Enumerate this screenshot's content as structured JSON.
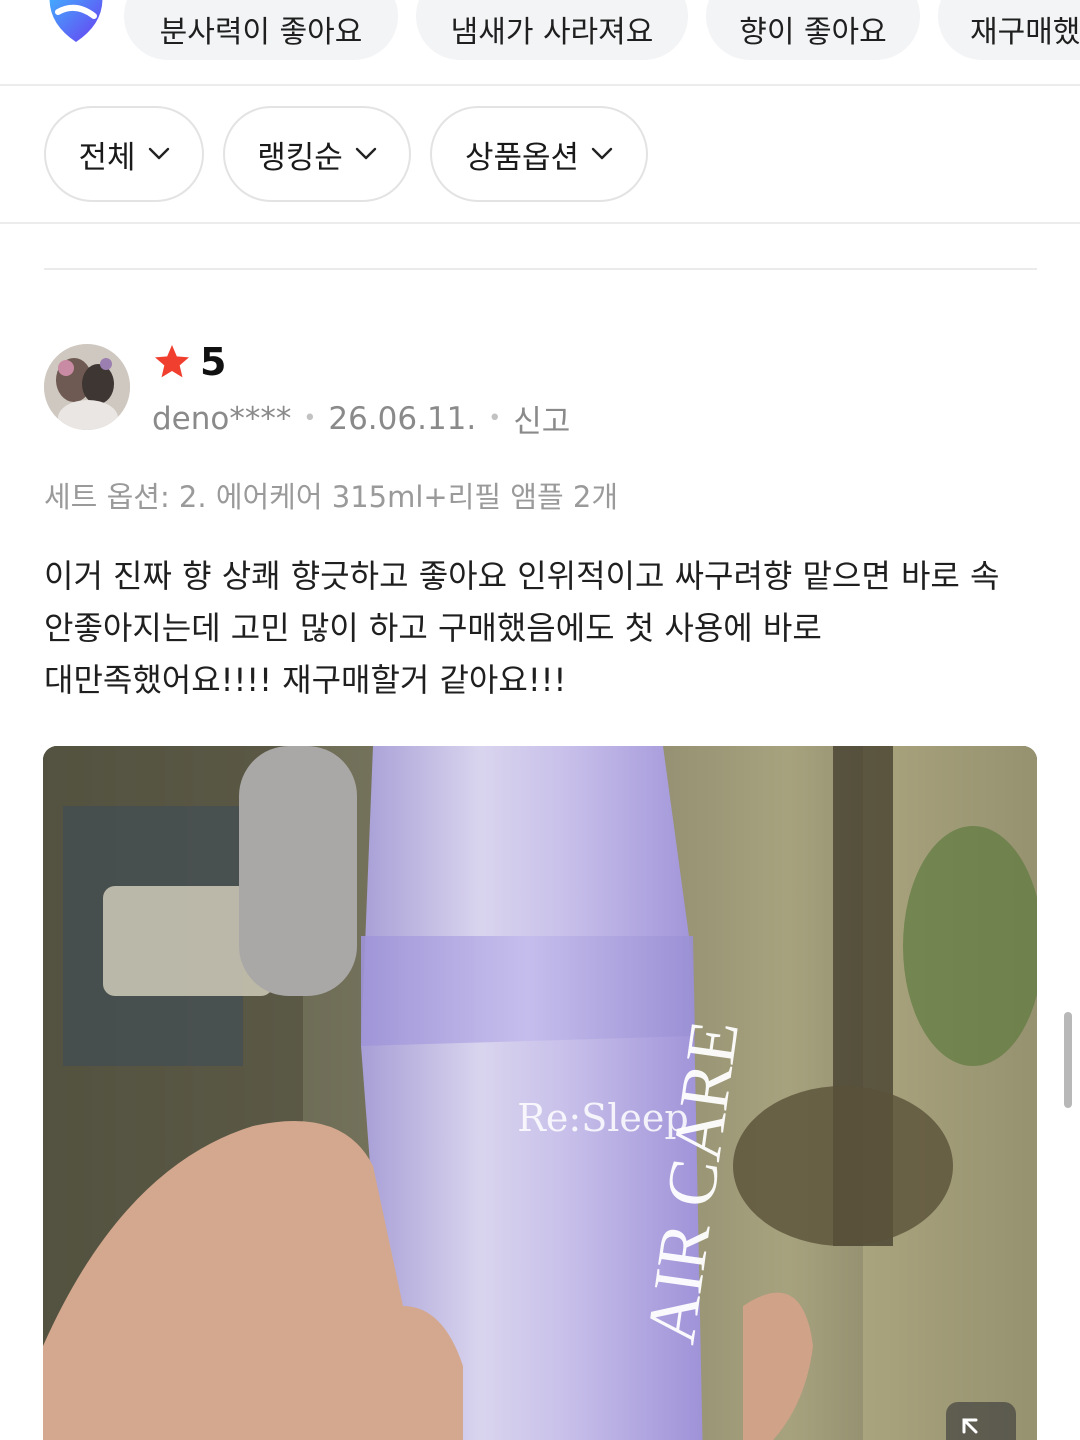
{
  "keyword_chips": [
    "분사력이 좋아요",
    "냄새가 사라져요",
    "향이 좋아요",
    "재구매했"
  ],
  "filters": [
    {
      "label": "전체"
    },
    {
      "label": "랭킹순"
    },
    {
      "label": "상품옵션"
    }
  ],
  "review": {
    "rating": "5",
    "user": "deno****",
    "date": "26.06.11.",
    "report": "신고",
    "option": "세트 옵션: 2. 에어케어 315ml+리필 앰플 2개",
    "text_lines": [
      "이거 진짜 향 상쾌 향긋하고 좋아요 인위적이고 싸구려향 맡으면 바로 속",
      "안좋아지는데 고민 많이 하고 구매했음에도 첫 사용에 바로",
      "대만족했어요!!!! 재구매할거 같아요!!!"
    ],
    "photo": {
      "brand_text": "Re:Sleep",
      "product_text": "AIR CARE"
    }
  },
  "colors": {
    "star": "#f03e2f",
    "chip_bg": "#f3f4f6",
    "meta_gray": "#8a8a8a",
    "bottle_purple": "#b3a8e0"
  },
  "icons": [
    "app-logo-icon",
    "chevron-down-icon",
    "star-icon",
    "expand-icon"
  ]
}
